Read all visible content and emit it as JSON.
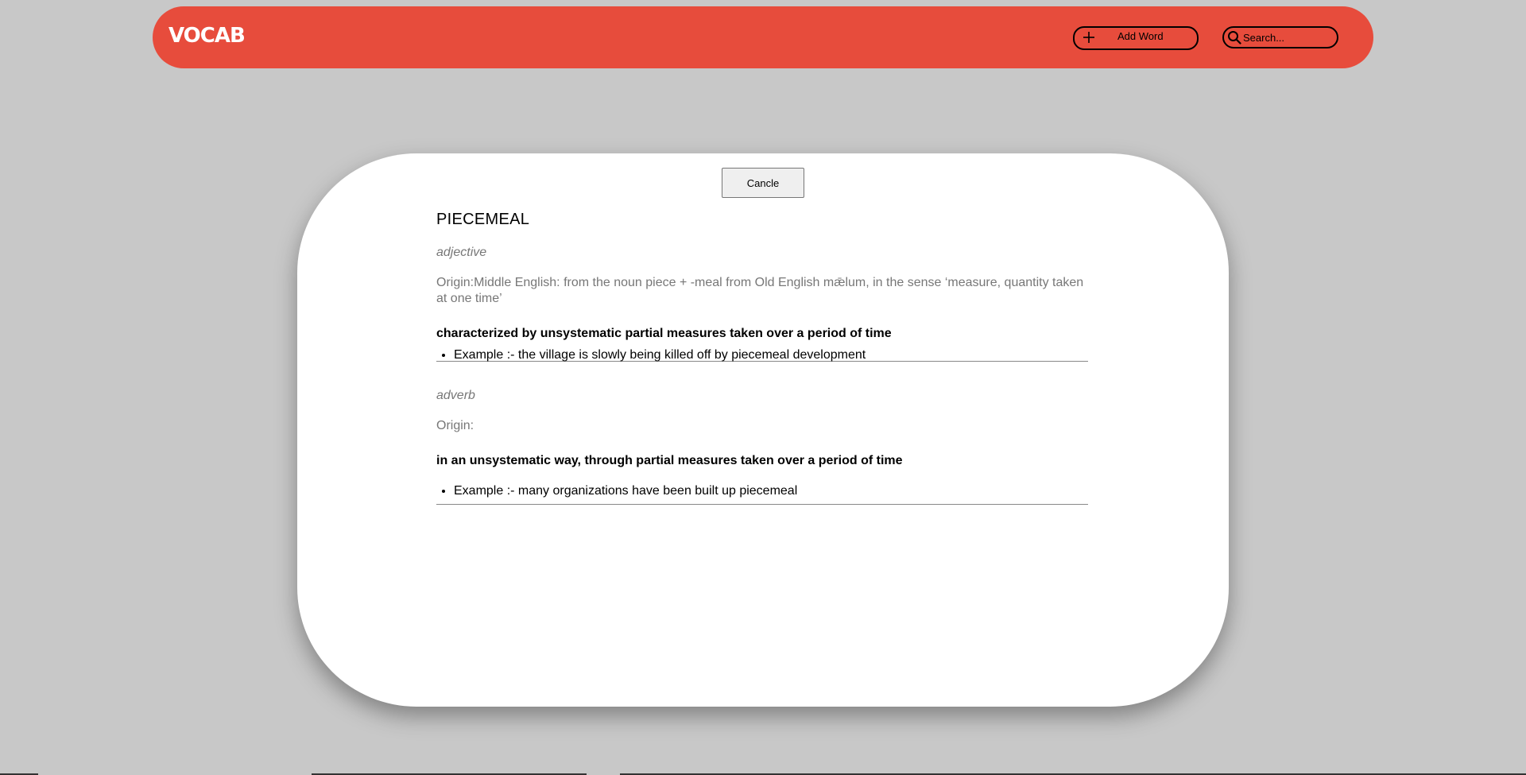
{
  "app": {
    "logo": "VOCAB"
  },
  "header": {
    "add_word_label": "Add Word",
    "search_placeholder": "Search..."
  },
  "modal": {
    "cancel_label": "Cancle",
    "word": "PIECEMEAL",
    "meanings": [
      {
        "part_of_speech": "adjective",
        "origin": "Origin:Middle English: from the noun piece + -meal from Old English mǣlum, in the sense ‘measure, quantity taken at one time’",
        "definition": "characterized by unsystematic partial measures taken over a period of time",
        "example": "Example :- the village is slowly being killed off by piecemeal development"
      },
      {
        "part_of_speech": "adverb",
        "origin": "Origin:",
        "definition": "in an unsystematic way, through partial measures taken over a period of time",
        "example": "Example :- many organizations have been built up piecemeal"
      }
    ]
  },
  "colors": {
    "navbar": "#e74c3c",
    "background": "#c8c8c8",
    "modal": "#ffffff"
  }
}
